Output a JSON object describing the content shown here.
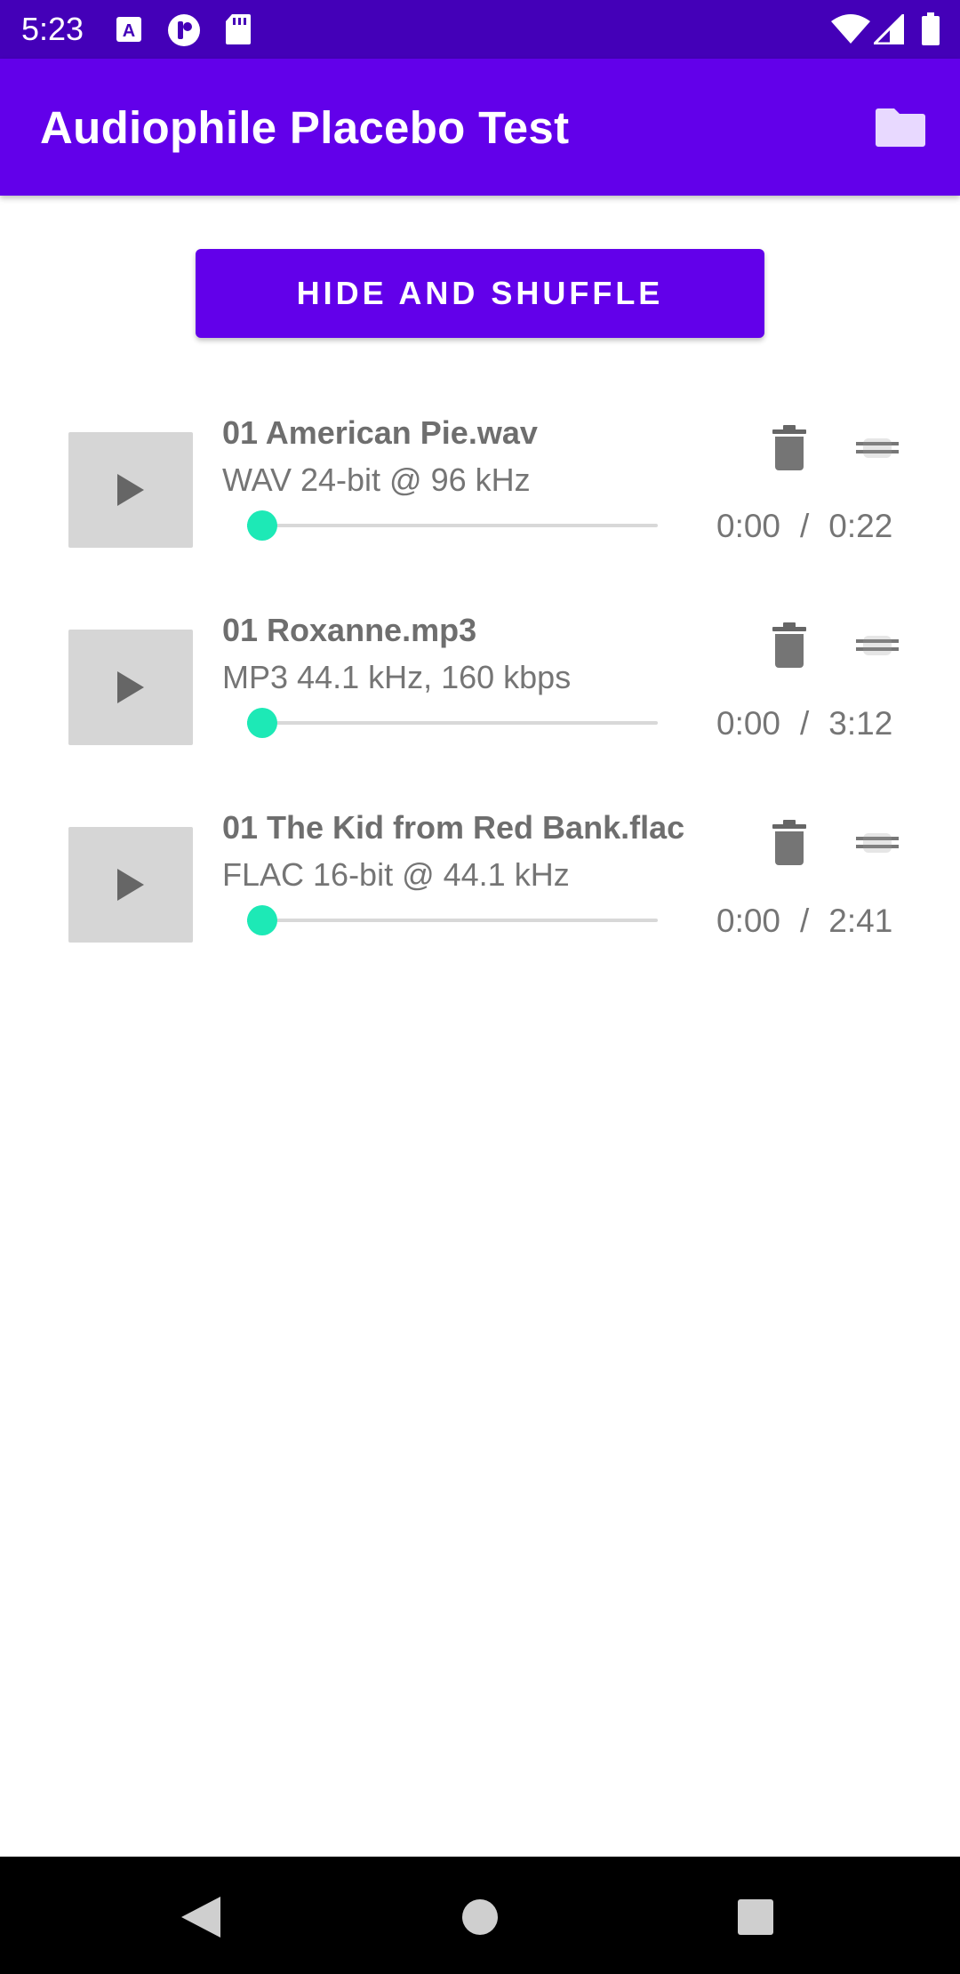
{
  "status_bar": {
    "time": "5:23",
    "left_icons": [
      "accessibility-a-icon",
      "podcast-icon",
      "sd-card-icon"
    ],
    "right_icons": [
      "wifi-icon",
      "cell-signal-icon",
      "battery-icon"
    ]
  },
  "app_bar": {
    "title": "Audiophile Placebo Test",
    "action_icon": "folder-icon"
  },
  "shuffle_button": {
    "label": "HIDE AND SHUFFLE"
  },
  "tracks": [
    {
      "title": "01 American Pie.wav",
      "format": "WAV 24-bit @ 96 kHz",
      "position": "0:00",
      "duration": "0:22",
      "progress": 0
    },
    {
      "title": "01 Roxanne.mp3",
      "format": "MP3 44.1 kHz, 160 kbps",
      "position": "0:00",
      "duration": "3:12",
      "progress": 0
    },
    {
      "title": "01 The Kid from Red Bank.flac",
      "format": "FLAC 16-bit @ 44.1 kHz",
      "position": "0:00",
      "duration": "2:41",
      "progress": 0
    }
  ],
  "time_separator": "/",
  "colors": {
    "status_bar": "#4400b8",
    "primary": "#6200ea",
    "accent": "#1de9b6",
    "play_tile": "#d6d6d6",
    "nav_bar": "#000000"
  },
  "nav_bar": {
    "icons": [
      "back-icon",
      "home-icon",
      "recents-icon"
    ]
  }
}
